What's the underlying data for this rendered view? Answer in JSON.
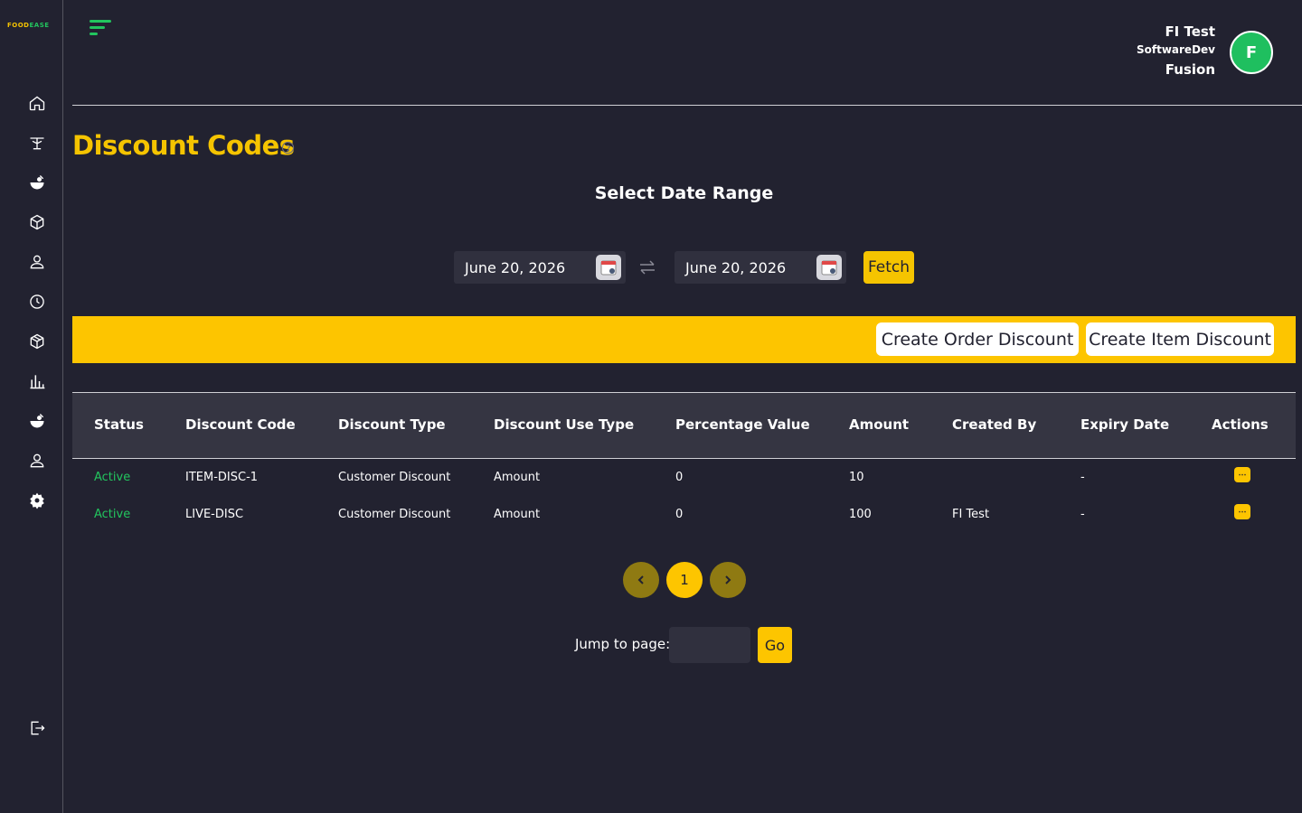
{
  "brand": {
    "logo_part1": "FOOD",
    "logo_part2": "EASE"
  },
  "sidebar": {
    "items": [
      {
        "icon": "home-icon"
      },
      {
        "icon": "dining-table-icon"
      },
      {
        "icon": "food-bowl-icon"
      },
      {
        "icon": "box-icon"
      },
      {
        "icon": "user-icon"
      },
      {
        "icon": "clock-icon"
      },
      {
        "icon": "package-icon"
      },
      {
        "icon": "bar-chart-icon"
      },
      {
        "icon": "food-bowl-icon"
      },
      {
        "icon": "user-icon"
      },
      {
        "icon": "settings-gear-icon"
      }
    ],
    "logout_icon": "logout-icon"
  },
  "user": {
    "name": "FI Test",
    "role": "SoftwareDev",
    "org": "Fusion",
    "avatar_letter": "F"
  },
  "page": {
    "title": "Discount Codes",
    "date_range_title": "Select Date Range",
    "start_date": "June 20, 2026",
    "end_date": "June 20, 2026",
    "fetch_label": "Fetch"
  },
  "actions": {
    "create_order_discount": "Create Order Discount",
    "create_item_discount": "Create Item Discount"
  },
  "table": {
    "headers": {
      "status": "Status",
      "code": "Discount Code",
      "type": "Discount Type",
      "use_type": "Discount Use Type",
      "percentage": "Percentage Value",
      "amount": "Amount",
      "created_by": "Created By",
      "expiry": "Expiry Date",
      "actions": "Actions"
    },
    "rows": [
      {
        "status": "Active",
        "code": "ITEM-DISC-1",
        "type": "Customer Discount",
        "use_type": "Amount",
        "percentage": "0",
        "amount": "10",
        "created_by": "",
        "expiry": "-",
        "more": "⋯"
      },
      {
        "status": "Active",
        "code": "LIVE-DISC",
        "type": "Customer Discount",
        "use_type": "Amount",
        "percentage": "0",
        "amount": "100",
        "created_by": "FI Test",
        "expiry": "-",
        "more": "⋯"
      }
    ]
  },
  "pagination": {
    "current_page": "1",
    "jump_label": "Jump to page:",
    "jump_value": "",
    "go_label": "Go"
  },
  "colors": {
    "accent": "#fdc500",
    "background": "#222230",
    "status_active": "#22c55e",
    "avatar": "#1fbf5f"
  }
}
